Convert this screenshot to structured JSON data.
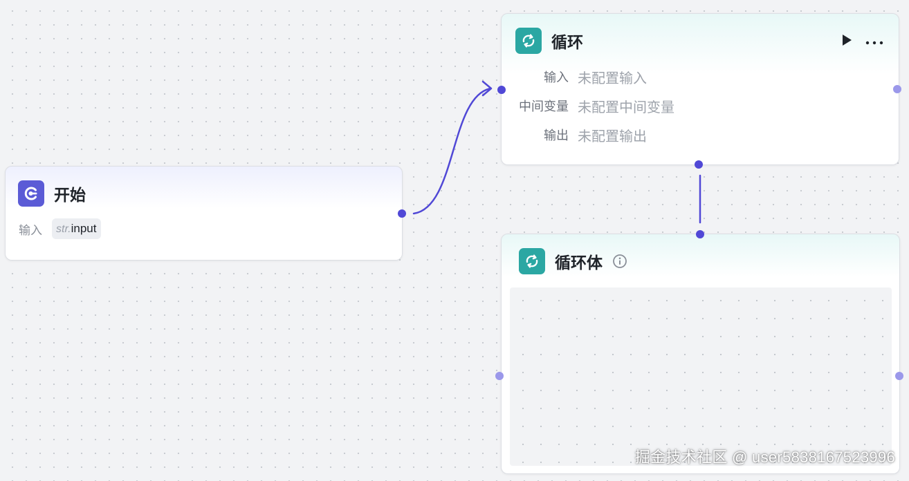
{
  "canvas": {
    "background": "#f2f3f5",
    "accent": "#5048d6",
    "loop_accent": "#2ba7a3"
  },
  "start_node": {
    "title": "开始",
    "icon": "start-icon",
    "input_label": "输入",
    "input_var": {
      "type": "str.",
      "name": "input"
    }
  },
  "loop_node": {
    "title": "循环",
    "icon": "loop-icon",
    "actions": [
      "play-icon",
      "more-icon"
    ],
    "rows": [
      {
        "label": "输入",
        "value": "未配置输入"
      },
      {
        "label": "中间变量",
        "value": "未配置中间变量"
      },
      {
        "label": "输出",
        "value": "未配置输出"
      }
    ]
  },
  "loop_body_node": {
    "title": "循环体",
    "icon": "loop-icon",
    "info_icon": "info-icon"
  },
  "watermark": "掘金技术社区 @ user5838167523996"
}
